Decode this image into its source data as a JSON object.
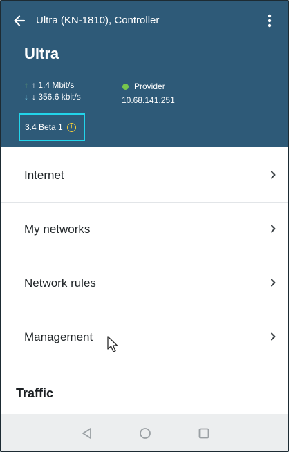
{
  "appbar": {
    "title": "Ultra (KN-1810), Controller",
    "back_icon": "arrow-left-icon",
    "more_icon": "more-vertical-icon"
  },
  "device": {
    "name": "Ultra",
    "upload_rate": "↑ 1.4 Mbit/s",
    "download_rate": "↓ 356.6 kbit/s",
    "provider_label": "Provider",
    "provider_ip": "10.68.141.251",
    "firmware_version": "3.4 Beta 1",
    "firmware_icon": "warning-icon"
  },
  "menu": {
    "items": [
      {
        "label": "Internet"
      },
      {
        "label": "My networks"
      },
      {
        "label": "Network rules"
      },
      {
        "label": "Management"
      }
    ]
  },
  "sections": {
    "traffic_title": "Traffic"
  },
  "colors": {
    "header_bg": "#2e5a78",
    "highlight_border": "#22d4ea",
    "status_green": "#77c64c",
    "warning_yellow": "#f2cd3b"
  }
}
